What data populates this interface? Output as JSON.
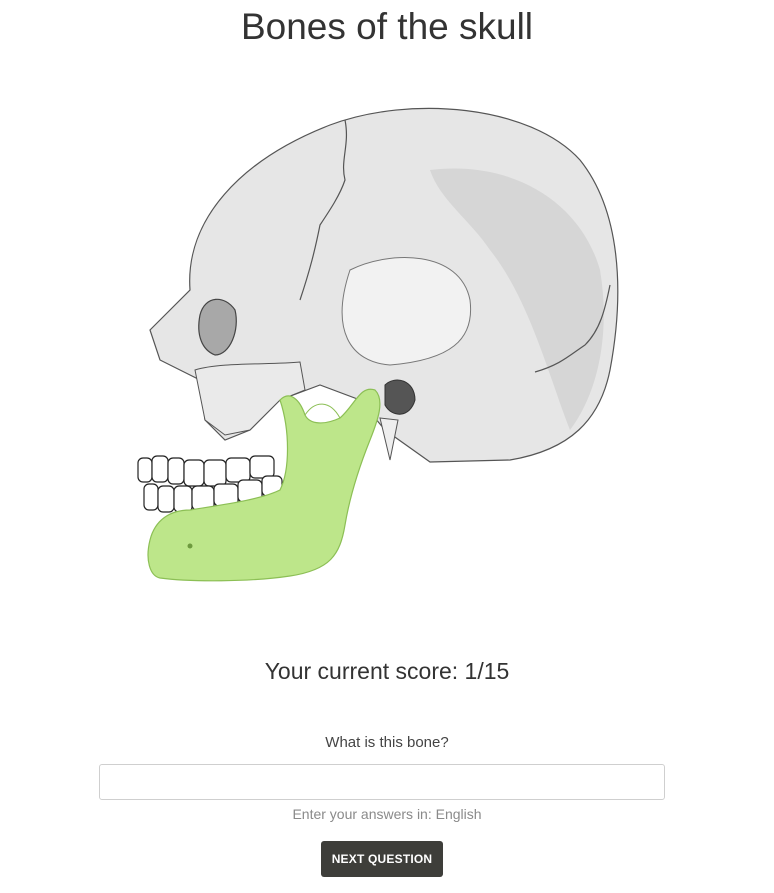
{
  "page": {
    "title": "Bones of the skull"
  },
  "quiz": {
    "score_text": "Your current score: 1/15",
    "question": "What is this bone?",
    "answer_value": "",
    "answer_placeholder": "",
    "language_hint": "Enter your answers in: English",
    "next_button_label": "NEXT QUESTION"
  },
  "illustration": {
    "subject": "skull-lateral-view",
    "highlighted_bone_color": "#bde68a",
    "bone_color": "#e4e4e4",
    "shadow_color": "#c4c4c4"
  },
  "colors": {
    "text": "#333333",
    "hint_text": "#8a8a8a",
    "button_bg": "#3e3e3a",
    "button_text": "#ffffff",
    "input_border": "#cfcfcf"
  }
}
